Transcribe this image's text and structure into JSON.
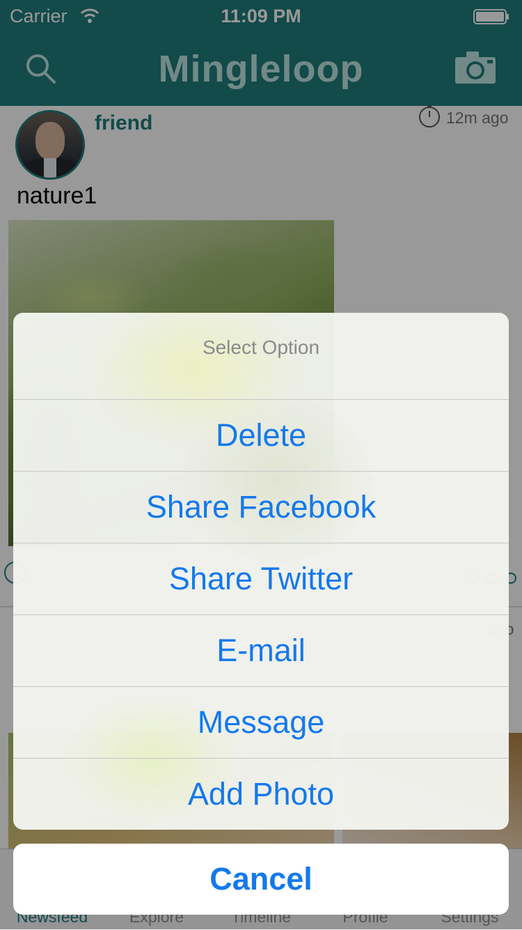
{
  "status_bar": {
    "carrier": "Carrier",
    "time": "11:09 PM"
  },
  "nav_bar": {
    "title": "Mingleloop"
  },
  "post": {
    "username": "friend",
    "time_ago": "12m ago",
    "caption": "nature1"
  },
  "post2": {
    "time_ago": "ago"
  },
  "tab_bar": {
    "items": [
      {
        "label": "Newsfeed"
      },
      {
        "label": "Explore"
      },
      {
        "label": "Timeline"
      },
      {
        "label": "Profile"
      },
      {
        "label": "Settings"
      }
    ]
  },
  "action_sheet": {
    "title": "Select Option",
    "options": [
      {
        "label": "Delete"
      },
      {
        "label": "Share Facebook"
      },
      {
        "label": "Share Twitter"
      },
      {
        "label": "E-mail"
      },
      {
        "label": "Message"
      },
      {
        "label": "Add Photo"
      }
    ],
    "cancel_label": "Cancel"
  },
  "colors": {
    "brand_teal": "#217c7c",
    "action_blue": "#1479ec",
    "title_gray": "#8a8a8a"
  },
  "icons": {
    "wifi": "wifi-icon",
    "battery": "battery-icon",
    "search": "search-icon",
    "camera": "camera-icon",
    "clock": "clock-icon"
  }
}
